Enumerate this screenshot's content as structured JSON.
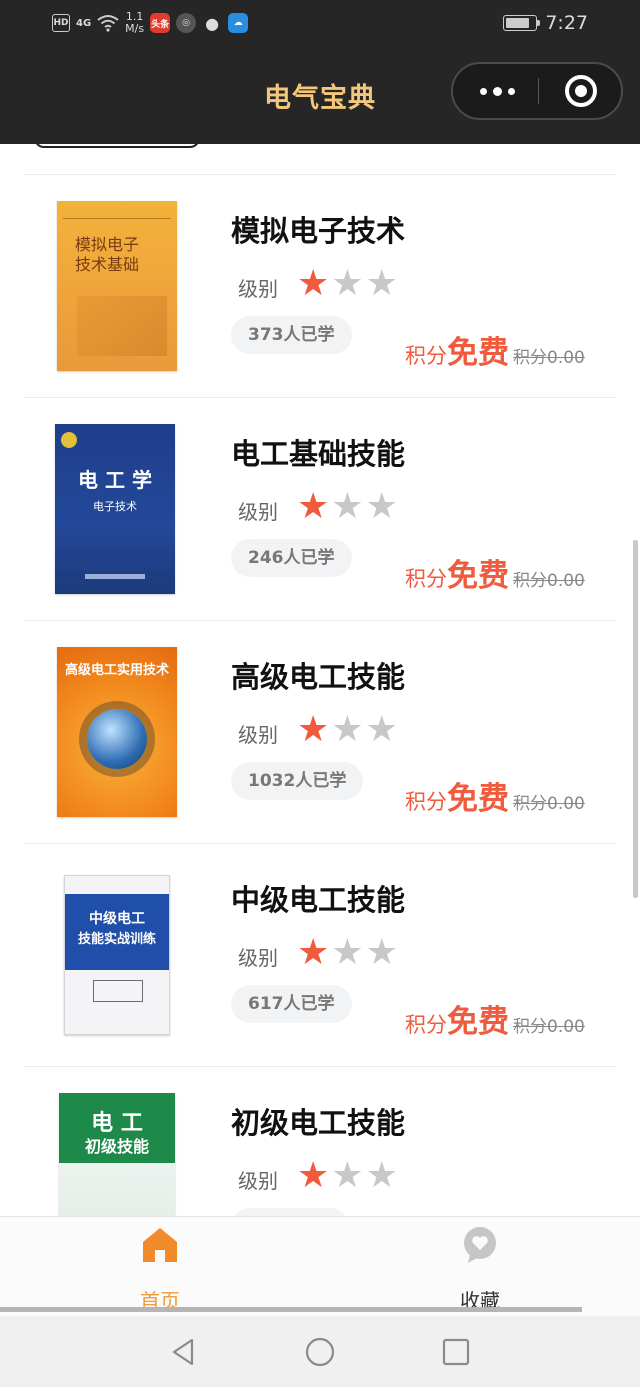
{
  "status_bar": {
    "network_badge": "HD",
    "signal": "4G",
    "speed_value": "1.1",
    "speed_unit": "M/s",
    "app_badge": "头条",
    "time": "7:27",
    "battery_level": 0.8
  },
  "nav": {
    "title": "电气宝典",
    "more_icon": "more-dots-icon",
    "close_icon": "target-close-icon"
  },
  "courses": [
    {
      "title": "模拟电子技术",
      "level_label": "级别",
      "rating": 1,
      "max_rating": 3,
      "learners": "373人已学",
      "price_label": "积分",
      "price_value": "免费",
      "orig_price": "积分0.00",
      "cover_text": [
        "模拟电子",
        "技术基础"
      ]
    },
    {
      "title": "电工基础技能",
      "level_label": "级别",
      "rating": 1,
      "max_rating": 3,
      "learners": "246人已学",
      "price_label": "积分",
      "price_value": "免费",
      "orig_price": "积分0.00",
      "cover_text": [
        "电 工 学",
        "电子技术"
      ]
    },
    {
      "title": "高级电工技能",
      "level_label": "级别",
      "rating": 1,
      "max_rating": 3,
      "learners": "1032人已学",
      "price_label": "积分",
      "price_value": "免费",
      "orig_price": "积分0.00",
      "cover_text": [
        "高级电工实用技术"
      ]
    },
    {
      "title": "中级电工技能",
      "level_label": "级别",
      "rating": 1,
      "max_rating": 3,
      "learners": "617人已学",
      "price_label": "积分",
      "price_value": "免费",
      "orig_price": "积分0.00",
      "cover_text": [
        "中级电工",
        "技能实战训练"
      ]
    },
    {
      "title": "初级电工技能",
      "level_label": "级别",
      "rating": 1,
      "max_rating": 3,
      "learners": "",
      "price_label": "",
      "price_value": "",
      "orig_price": "",
      "cover_text": [
        "电 工",
        "初级技能"
      ]
    }
  ],
  "tabbar": {
    "home_label": "首页",
    "fav_label": "收藏",
    "active_color": "#f29a3a"
  },
  "colors": {
    "header_bg": "#262626",
    "title": "#f3c77b",
    "accent_red": "#f05a3d",
    "star_off": "#c8c8c8"
  }
}
